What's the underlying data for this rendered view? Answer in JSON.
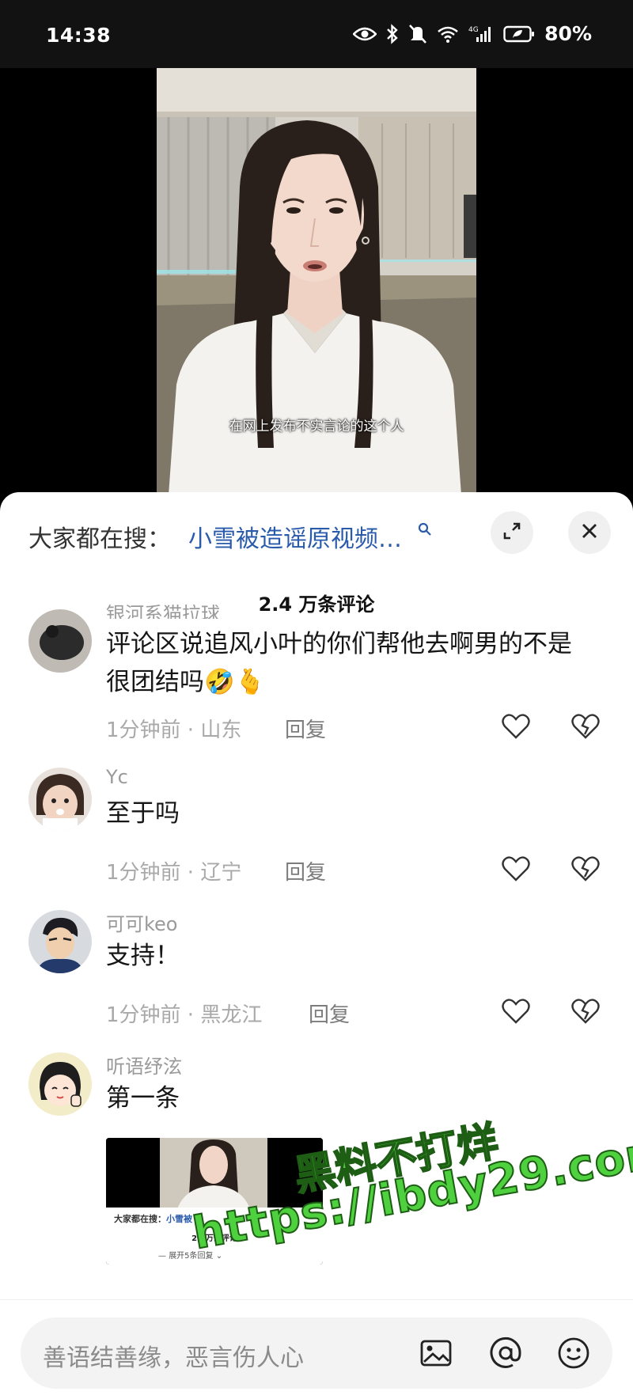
{
  "status_bar": {
    "time": "14:38",
    "battery": "80%",
    "network": "4G"
  },
  "video": {
    "subtitle": "在网上发布不实言论的这个人"
  },
  "sheet": {
    "search_prefix": "大家都在搜：",
    "search_term": "小雪被造谣原视频…",
    "comment_count": "2.4 万条评论"
  },
  "comments": [
    {
      "user": "银河系猫拉球",
      "text": "评论区说追风小叶的你们帮他去啊男的不是很团结吗🤣🫰",
      "time": "1分钟前",
      "location": "山东",
      "reply": "回复"
    },
    {
      "user": "Yc",
      "text": "至于吗",
      "time": "1分钟前",
      "location": "辽宁",
      "reply": "回复"
    },
    {
      "user": "可可keo",
      "text": "支持！",
      "time": "1分钟前",
      "location": "黑龙江",
      "reply": "回复"
    },
    {
      "user": "听语纾泫",
      "text": "第一条"
    }
  ],
  "attachment": {
    "search_prefix": "大家都在搜：",
    "search_term": "小雪被",
    "count": "2.4万条评论",
    "expand": "展开5条回复"
  },
  "watermark": {
    "line1": "黑料不打烊",
    "line2": "https://ibdy29.com"
  },
  "input": {
    "placeholder": "善语结善缘，恶言伤人心"
  },
  "icons": [
    "eye-icon",
    "bluetooth-icon",
    "mute-icon",
    "wifi-icon",
    "signal-icon",
    "battery-icon",
    "search-icon",
    "expand-icon",
    "close-icon",
    "heart-icon",
    "broken-heart-icon",
    "image-icon",
    "at-icon",
    "emoji-icon"
  ]
}
